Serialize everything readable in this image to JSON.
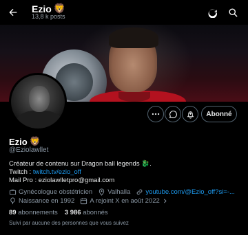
{
  "header": {
    "back_icon": "arrow-left-icon",
    "title": "Ezio",
    "title_emoji": "🦁",
    "posts_count": "13,8 k posts",
    "refresh_icon": "refresh-icon",
    "search_icon": "search-icon"
  },
  "profile": {
    "name": "Ezio",
    "name_emoji": "🦁",
    "handle": "@Eziolawllet",
    "follow_label": "Abonné",
    "more_icon": "more-icon",
    "message_icon": "message-icon",
    "notify_icon": "notification-plus-icon"
  },
  "bio": {
    "line1_text": "Créateur de contenu sur Dragon ball legends ",
    "line1_emoji": "🐉.",
    "twitch_prefix": "Twitch : ",
    "twitch_link": "twitch.tv/ezio_off",
    "mail_line": "Mail Pro : eziolawlletpro@gmail.com"
  },
  "meta": {
    "profession": "Gynécologue obstétricien",
    "location": "Valhalla",
    "website": "youtube.com/@Ezio_off?si=-...",
    "birth": "Naissance en 1992",
    "joined": "A rejoint X en août 2022"
  },
  "stats": {
    "following_count": "89",
    "following_label": "abonnements",
    "followers_count": "3 986",
    "followers_label": "abonnés",
    "followed_by": "Suivi par aucune des personnes que vous suivez"
  },
  "colors": {
    "link": "#1d9bf0",
    "muted": "#8b98a5",
    "text": "#e7e9ea"
  }
}
